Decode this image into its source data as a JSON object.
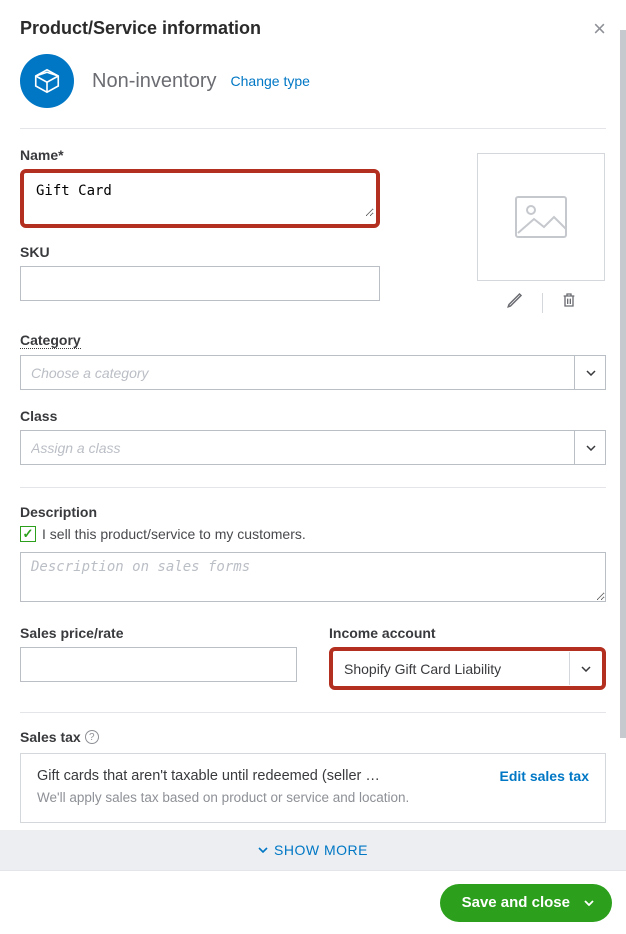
{
  "header": {
    "title": "Product/Service information"
  },
  "type": {
    "label": "Non-inventory",
    "change_link": "Change type"
  },
  "fields": {
    "name_label": "Name*",
    "name_value": "Gift Card",
    "sku_label": "SKU",
    "sku_value": "",
    "category_label": "Category",
    "category_placeholder": "Choose a category",
    "class_label": "Class",
    "class_placeholder": "Assign a class"
  },
  "description": {
    "label": "Description",
    "checkbox_text": "I sell this product/service to my customers.",
    "checkbox_checked": true,
    "placeholder": "Description on sales forms"
  },
  "pricing": {
    "sales_price_label": "Sales price/rate",
    "sales_price_value": "",
    "income_account_label": "Income account",
    "income_account_value": "Shopify Gift Card Liability"
  },
  "sales_tax": {
    "label": "Sales tax",
    "box_title": "Gift cards that aren't taxable until redeemed (seller …",
    "box_sub": "We'll apply sales tax based on product or service and location.",
    "edit_link": "Edit sales tax"
  },
  "show_more": "SHOW MORE",
  "footer": {
    "save_label": "Save and close"
  }
}
